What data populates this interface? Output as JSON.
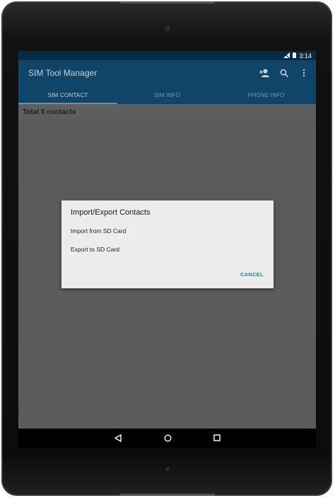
{
  "status_bar": {
    "time": "3:14",
    "icons": [
      "signal-icon",
      "battery-icon"
    ]
  },
  "app_bar": {
    "title": "SIM Tool Manager",
    "actions": [
      "add-contact-icon",
      "search-icon",
      "overflow-menu-icon"
    ]
  },
  "tabs": [
    {
      "label": "SIM CONTACT",
      "active": true
    },
    {
      "label": "SIM INFO",
      "active": false
    },
    {
      "label": "PHONE INFO",
      "active": false
    }
  ],
  "summary": {
    "text": "Total 0 contacts"
  },
  "dialog": {
    "title": "Import/Export Contacts",
    "options": [
      "Import from SD Card",
      "Export to SD Card"
    ],
    "cancel_label": "CANCEL"
  },
  "navigation": {
    "buttons": [
      "back-icon",
      "home-icon",
      "recents-icon"
    ]
  },
  "colors": {
    "status_bar": "#022b44",
    "app_bar": "#0f4569",
    "dialog_background": "#ececec",
    "cancel_accent": "#168a8a",
    "scrim": "#5b5b5b"
  }
}
